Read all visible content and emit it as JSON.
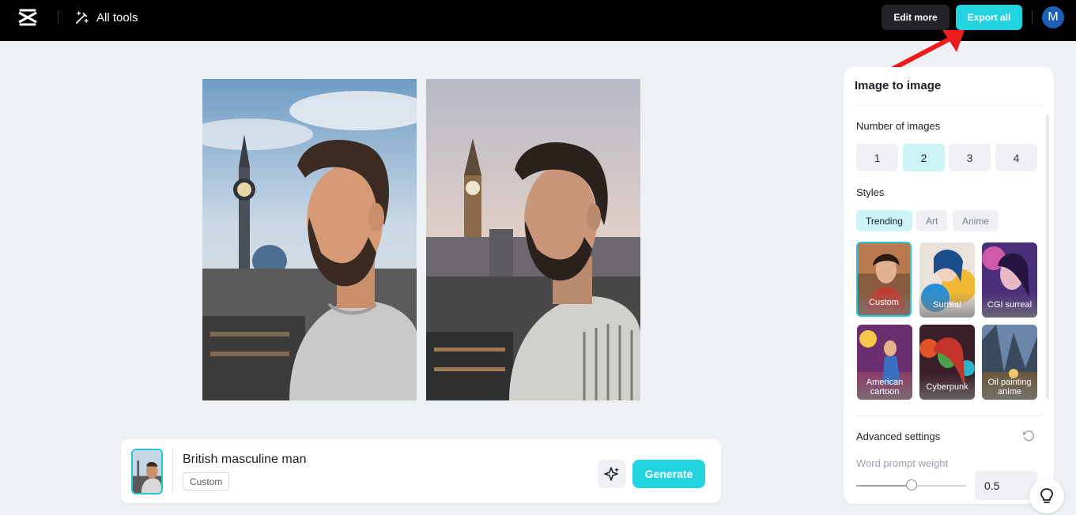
{
  "header": {
    "all_tools_label": "All tools",
    "edit_more_label": "Edit more",
    "export_all_label": "Export all",
    "avatar_initial": "M"
  },
  "prompt": {
    "text": "British masculine man",
    "style_tag": "Custom",
    "generate_label": "Generate"
  },
  "panel": {
    "title": "Image to image",
    "number_of_images_label": "Number of images",
    "number_options": [
      "1",
      "2",
      "3",
      "4"
    ],
    "selected_number": "2",
    "styles_label": "Styles",
    "style_tabs": [
      "Trending",
      "Art",
      "Anime"
    ],
    "active_style_tab": "Trending",
    "styles": [
      {
        "label": "Custom",
        "selected": true
      },
      {
        "label": "Surreal",
        "selected": false
      },
      {
        "label": "CGI surreal",
        "selected": false
      },
      {
        "label": "American cartoon",
        "selected": false
      },
      {
        "label": "Cyberpunk",
        "selected": false
      },
      {
        "label": "Oil painting anime",
        "selected": false
      }
    ],
    "advanced_settings_label": "Advanced settings",
    "word_prompt_weight_label": "Word prompt weight",
    "word_prompt_weight_value": "0.5",
    "word_prompt_weight_fraction": 0.5
  },
  "colors": {
    "accent": "#22d3e0",
    "accent_light": "#ccf3f6",
    "annotation_arrow": "#ee1c1c"
  }
}
